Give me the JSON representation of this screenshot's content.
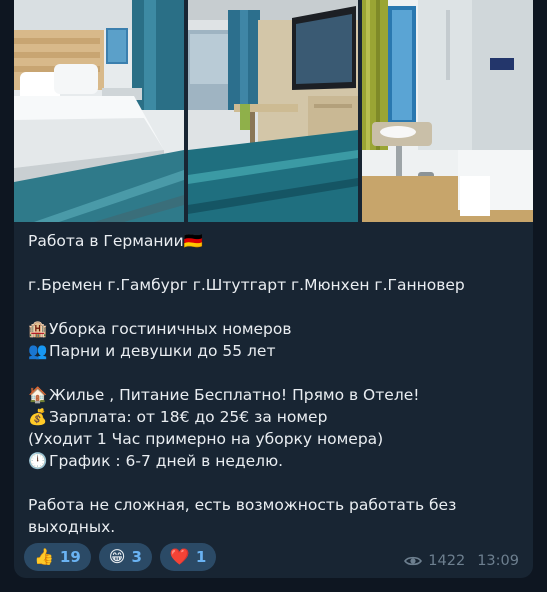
{
  "message": {
    "lines": [
      {
        "text": "Работа в Германии",
        "emoji": "🇩🇪",
        "emoji_pos": "after"
      },
      {
        "text": ""
      },
      {
        "text": "г.Бремен г.Гамбург г.Штутгарт г.Мюнхен г.Ганновер"
      },
      {
        "text": ""
      },
      {
        "text": "Уборка гостиничных номеров",
        "emoji": "🏨",
        "emoji_pos": "before"
      },
      {
        "text": "Парни и девушки до 55 лет",
        "emoji": "👥",
        "emoji_pos": "before"
      },
      {
        "text": ""
      },
      {
        "text": "Жилье , Питание Бесплатно! Прямо в Отеле!",
        "emoji": "🏠",
        "emoji_pos": "before"
      },
      {
        "text": "Зарплата: от 18€ до 25€ за номер",
        "emoji": "💰",
        "emoji_pos": "before"
      },
      {
        "text": "(Уходит 1 Час примерно на уборку номера)"
      },
      {
        "text": "График : 6-7 дней в неделю.",
        "emoji": "🕛",
        "emoji_pos": "before"
      },
      {
        "text": ""
      },
      {
        "text": "Работа не сложная, есть возможность работать без выходных.",
        "wrap": true
      }
    ]
  },
  "photos": [
    {
      "icon": "hotel-bedroom-photo"
    },
    {
      "icon": "hotel-room-desk-photo"
    },
    {
      "icon": "hotel-bathroom-photo"
    }
  ],
  "reactions": [
    {
      "emoji": "👍",
      "count": "19"
    },
    {
      "emoji": "😁",
      "count": "3"
    },
    {
      "emoji": "❤️",
      "count": "1"
    }
  ],
  "meta": {
    "views": "1422",
    "time": "13:09"
  },
  "colors": {
    "bubble": "#182533",
    "background": "#0e1621",
    "text": "#e9edf1",
    "reaction_bg": "#2b4a66",
    "reaction_count": "#6ab3f3",
    "meta": "#6d7f8f"
  }
}
